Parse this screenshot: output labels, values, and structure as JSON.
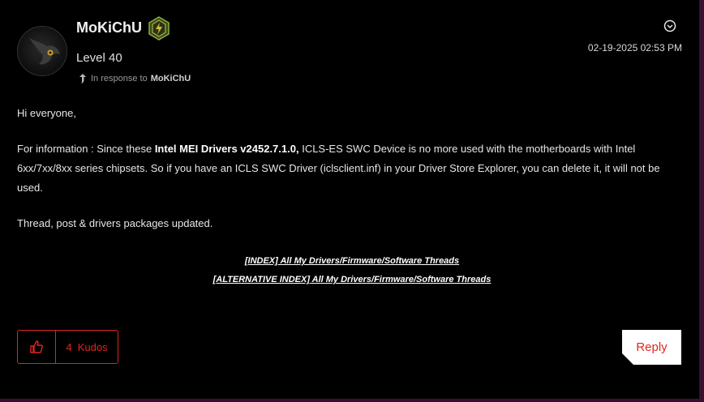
{
  "post": {
    "author": "MoKiChU",
    "level": "Level 40",
    "in_response_prefix": "In response to",
    "in_response_to": "MoKiChU",
    "timestamp": "02-19-2025 02:53 PM",
    "greeting": "Hi everyone,",
    "info_prefix": "For information : Since these ",
    "info_bold": "Intel MEI Drivers v2452.7.1.0,",
    "info_rest": " ICLS-ES SWC Device is no more used with the motherboards with Intel 6xx/7xx/8xx series chipsets. So if you have an ICLS SWC Driver (iclsclient.inf) in your Driver Store Explorer, you can delete it, it will not be used.",
    "update_note": "Thread, post & drivers packages updated.",
    "link_index": "[INDEX] All My Drivers/Firmware/Software Threads",
    "link_alt_index": "[ALTERNATIVE INDEX] All My Drivers/Firmware/Software Threads"
  },
  "actions": {
    "kudos_label": "4  Kudos",
    "reply_label": "Reply"
  },
  "colors": {
    "accent": "#e0261f",
    "background": "#000000",
    "frame": "#3a1030"
  },
  "icons": {
    "avatar": "avatar-icon",
    "rank": "rank-badge-icon",
    "options": "options-chevron-icon",
    "thumb": "thumbs-up-icon",
    "reply_arrow": "reply-arrow-icon"
  }
}
